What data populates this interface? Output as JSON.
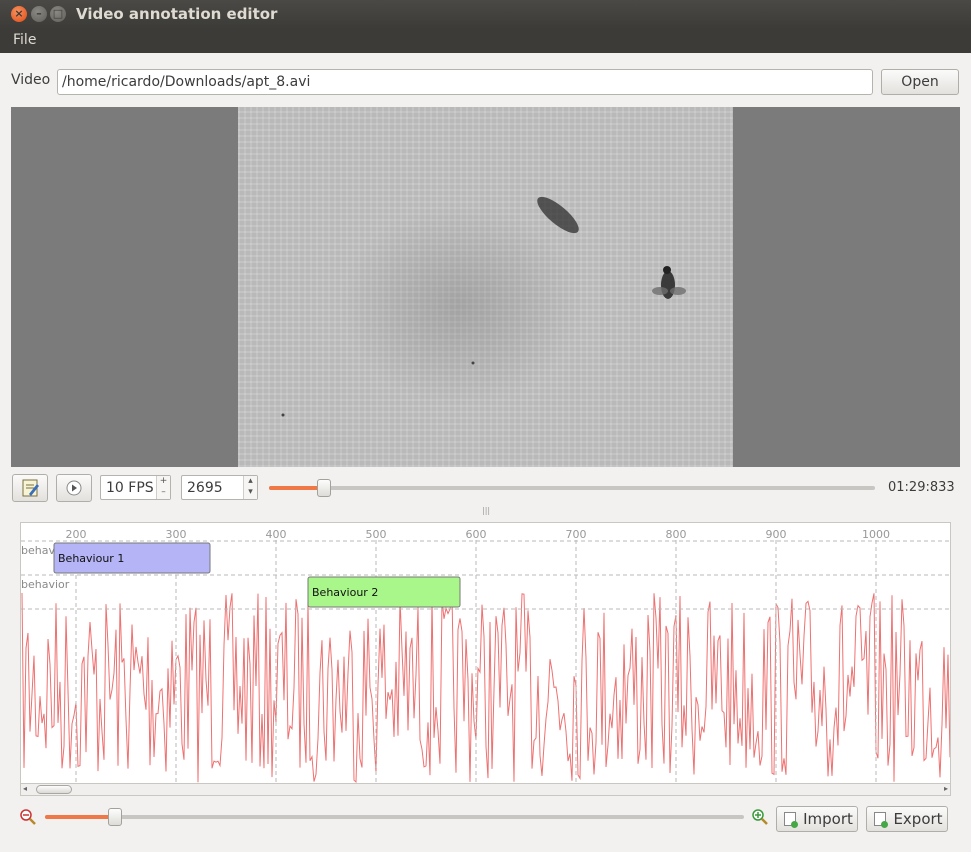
{
  "window": {
    "title": "Video annotation editor"
  },
  "menu": {
    "file": "File"
  },
  "video_row": {
    "label": "Video",
    "path": "/home/ricardo/Downloads/apt_8.avi",
    "open_label": "Open"
  },
  "controls": {
    "fps": "10 FPS",
    "frame": "2695",
    "time": "01:29:833",
    "position_fraction": 0.09
  },
  "timeline": {
    "ticks": [
      "200",
      "300",
      "400",
      "500",
      "600",
      "700",
      "800",
      "900",
      "1000"
    ],
    "rows": [
      "behavior",
      "behavior"
    ],
    "events": [
      {
        "label": "Behaviour 1",
        "start": 178,
        "end": 334,
        "color": "#b4b4f7"
      },
      {
        "label": "Behaviour 2",
        "start": 432,
        "end": 584,
        "color": "#a9f78a"
      }
    ],
    "signal_color": "#f07070"
  },
  "zoom": {
    "level_fraction": 0.1
  },
  "bottom": {
    "import_label": "Import",
    "export_label": "Export"
  }
}
